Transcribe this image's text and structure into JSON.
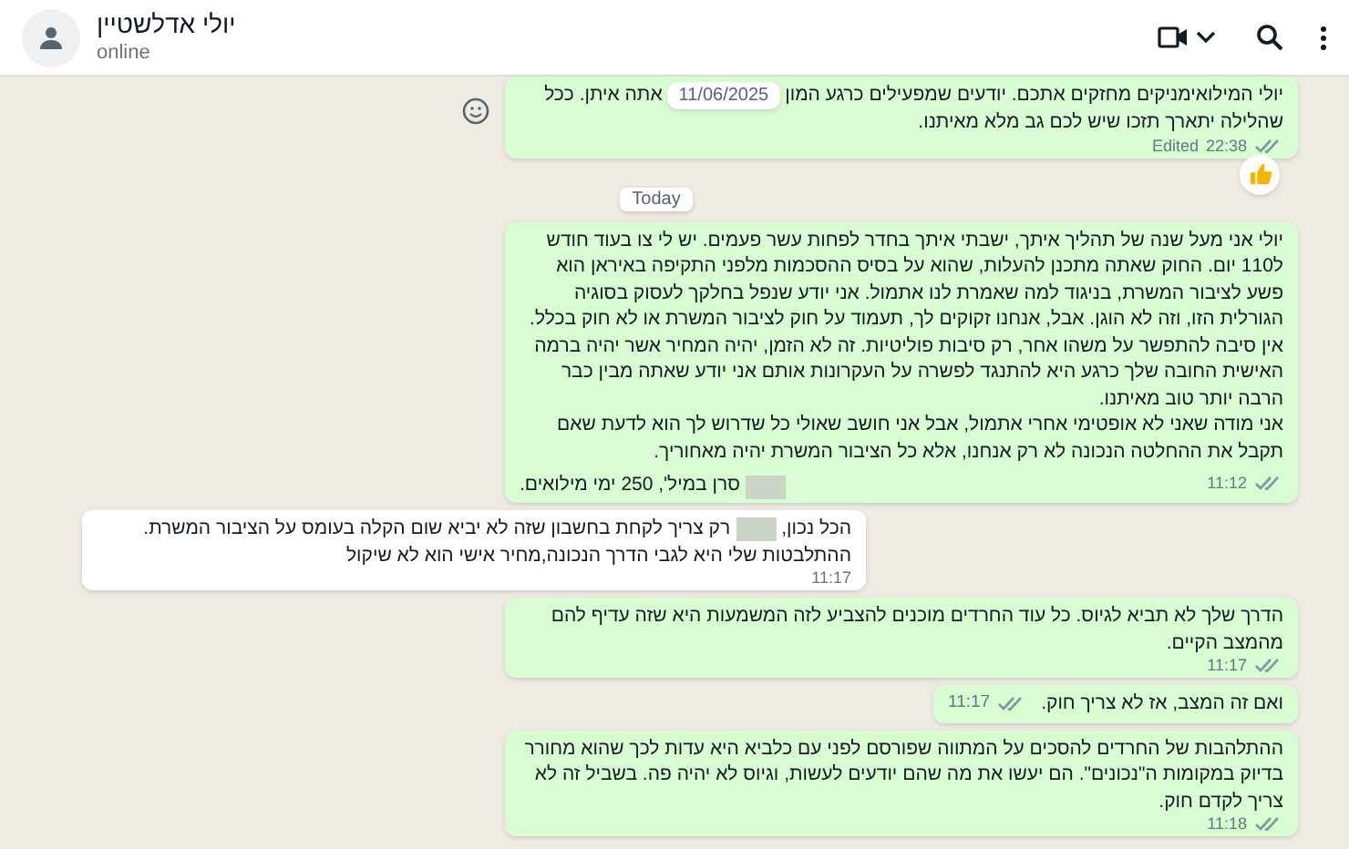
{
  "contact": {
    "name": "יולי אדלשטיין",
    "status": "online"
  },
  "messages": [
    {
      "kind": "outgoing",
      "lines": [
        [
          {
            "kind": "text",
            "text": "יולי המילואימניקים מחזקים אתכם. יודעים שמפעילים כרגע המון"
          },
          {
            "kind": "date_chip",
            "text": "11/06/2025"
          },
          {
            "kind": "text",
            "text": "אתה איתן. ככל"
          }
        ],
        [
          {
            "kind": "text",
            "text": "שהלילה יתארך תזכו שיש לכם גב מלא מאיתנו."
          }
        ]
      ],
      "edited": "Edited",
      "time": "22:38",
      "reaction": true,
      "hovered": true
    },
    {
      "kind": "day",
      "text": "Today"
    },
    {
      "kind": "outgoing",
      "lines": [
        [
          {
            "kind": "text",
            "text": "יולי אני מעל שנה של תהליך איתך, ישבתי איתך בחדר לפחות עשר פעמים. יש לי צו בעוד חודש ל110 יום. החוק שאתה מתכנן להעלות, שהוא על בסיס ההסכמות מלפני התקיפה באיראן הוא פשע לציבור המשרת, בניגוד למה שאמרת לנו אתמול. אני יודע שנפל בחלקך לעסוק בסוגיה הגורלית הזו, וזה לא הוגן. אבל, אנחנו זקוקים לך, תעמוד על חוק לציבור המשרת או לא חוק בכלל. אין סיבה להתפשר על משהו אחר, רק סיבות פוליטיות. זה לא הזמן, יהיה המחיר אשר יהיה ברמה האישית החובה שלך כרגע היא להתנגד לפשרה על העקרונות אותם אני יודע שאתה מבין כבר הרבה יותר טוב מאיתנו."
          }
        ],
        [
          {
            "kind": "text",
            "text": "אני מודה שאני לא אופטימי אחרי אתמול, אבל אני חושב שאולי כל שדרוש לך הוא לדעת שאם תקבל את ההחלטה הנכונה לא רק אנחנו, אלא כל הציבור המשרת יהיה מאחוריך."
          }
        ]
      ],
      "signature": [
        {
          "kind": "redacted"
        },
        {
          "kind": "text",
          "text": "סרן במיל', 250 ימי מילואים."
        }
      ],
      "time": "11:12"
    },
    {
      "kind": "incoming",
      "lines": [
        [
          {
            "kind": "text",
            "text": "הכל נכון,"
          },
          {
            "kind": "redacted"
          },
          {
            "kind": "text",
            "text": "רק צריך לקחת בחשבון שזה לא יביא שום הקלה בעומס על הציבור המשרת."
          }
        ],
        [
          {
            "kind": "text",
            "text": "ההתלבטות שלי היא לגבי הדרך הנכונה,מחיר אישי הוא לא שיקול"
          }
        ]
      ],
      "time": "11:17"
    },
    {
      "kind": "outgoing",
      "lines": [
        [
          {
            "kind": "text",
            "text": "הדרך שלך לא תביא לגיוס. כל עוד החרדים מוכנים להצביע לזה המשמעות היא שזה עדיף להם מהמצב הקיים."
          }
        ]
      ],
      "time": "11:17"
    },
    {
      "kind": "outgoing",
      "time_inline": true,
      "lines": [
        [
          {
            "kind": "text",
            "text": "ואם זה המצב, אז לא צריך חוק."
          }
        ]
      ],
      "time": "11:17"
    },
    {
      "kind": "outgoing",
      "lines": [
        [
          {
            "kind": "text",
            "text": "ההתלהבות של החרדים להסכים על המתווה שפורסם לפני עם כלביא היא עדות לכך שהוא מחורר בדיוק במקומות ה\"נכונים\". הם יעשו את מה שהם יודעים לעשות, וגיוס לא יהיה פה. בשביל זה לא צריך לקדם חוק."
          }
        ]
      ],
      "time": "11:18"
    }
  ]
}
